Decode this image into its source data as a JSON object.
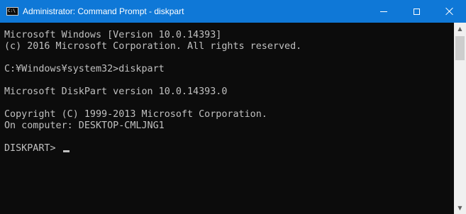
{
  "window": {
    "title": "Administrator: Command Prompt - diskpart",
    "icon_label": "C:\\",
    "colors": {
      "titlebar": "#0f78d7",
      "console_bg": "#0c0c0c",
      "console_fg": "#c0c0c0"
    }
  },
  "controls": {
    "minimize_icon": "minimize-icon",
    "maximize_icon": "maximize-icon",
    "close_icon": "close-icon"
  },
  "console": {
    "lines": [
      "Microsoft Windows [Version 10.0.14393]",
      "(c) 2016 Microsoft Corporation. All rights reserved.",
      "",
      "C:¥Windows¥system32>diskpart",
      "",
      "Microsoft DiskPart version 10.0.14393.0",
      "",
      "Copyright (C) 1999-2013 Microsoft Corporation.",
      "On computer: DESKTOP-CMLJNG1",
      ""
    ],
    "prompt": "DISKPART> "
  },
  "scrollbar": {
    "up_arrow": "▲",
    "down_arrow": "▼"
  }
}
